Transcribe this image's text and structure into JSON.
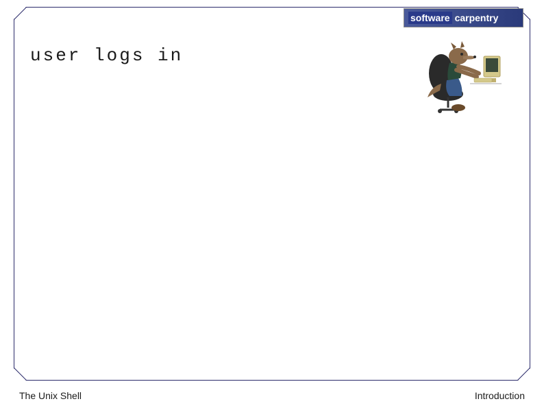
{
  "logo": {
    "part1": "software",
    "part2": "carpentry"
  },
  "slide": {
    "title": "user logs in"
  },
  "illustration": {
    "name": "wolf-at-computer"
  },
  "footer": {
    "left": "The Unix Shell",
    "right": "Introduction"
  }
}
